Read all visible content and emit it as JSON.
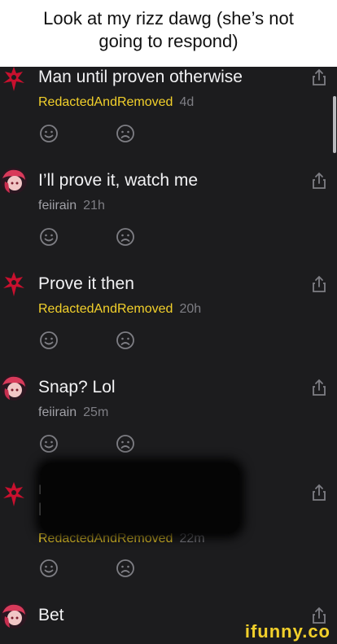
{
  "caption": "Look at my rizz dawg (she’s not going to respond)",
  "colors": {
    "background": "#1c1c1e",
    "author_highlight": "#f2d02b",
    "author_plain": "#a0a0a6",
    "time": "#7e7e84",
    "icon": "#7e7e84",
    "caption_bg": "#ffffff"
  },
  "comments": [
    {
      "text": "Man until proven otherwise",
      "author": "RedactedAndRemoved",
      "time": "4d",
      "avatar": "red-glyph-avatar",
      "author_style": "highlight"
    },
    {
      "text": "I’ll prove it, watch me",
      "author": "feiirain",
      "time": "21h",
      "avatar": "anime-avatar",
      "author_style": "plain"
    },
    {
      "text": "Prove it then",
      "author": "RedactedAndRemoved",
      "time": "20h",
      "avatar": "red-glyph-avatar",
      "author_style": "highlight"
    },
    {
      "text": "Snap? Lol",
      "author": "feiirain",
      "time": "25m",
      "avatar": "anime-avatar",
      "author_style": "plain"
    },
    {
      "text": "",
      "author": "RedactedAndRemoved",
      "time": "22m",
      "avatar": "red-glyph-avatar",
      "author_style": "highlight",
      "redacted": true,
      "visible_fragments": [
        "r",
        "l"
      ]
    },
    {
      "text": "Bet",
      "author": "",
      "time": "",
      "avatar": "anime-avatar",
      "author_style": "plain"
    }
  ],
  "reaction_icons": [
    "smile-icon",
    "frown-icon"
  ],
  "share_icon": "share-icon",
  "watermark": "ifunny.co"
}
